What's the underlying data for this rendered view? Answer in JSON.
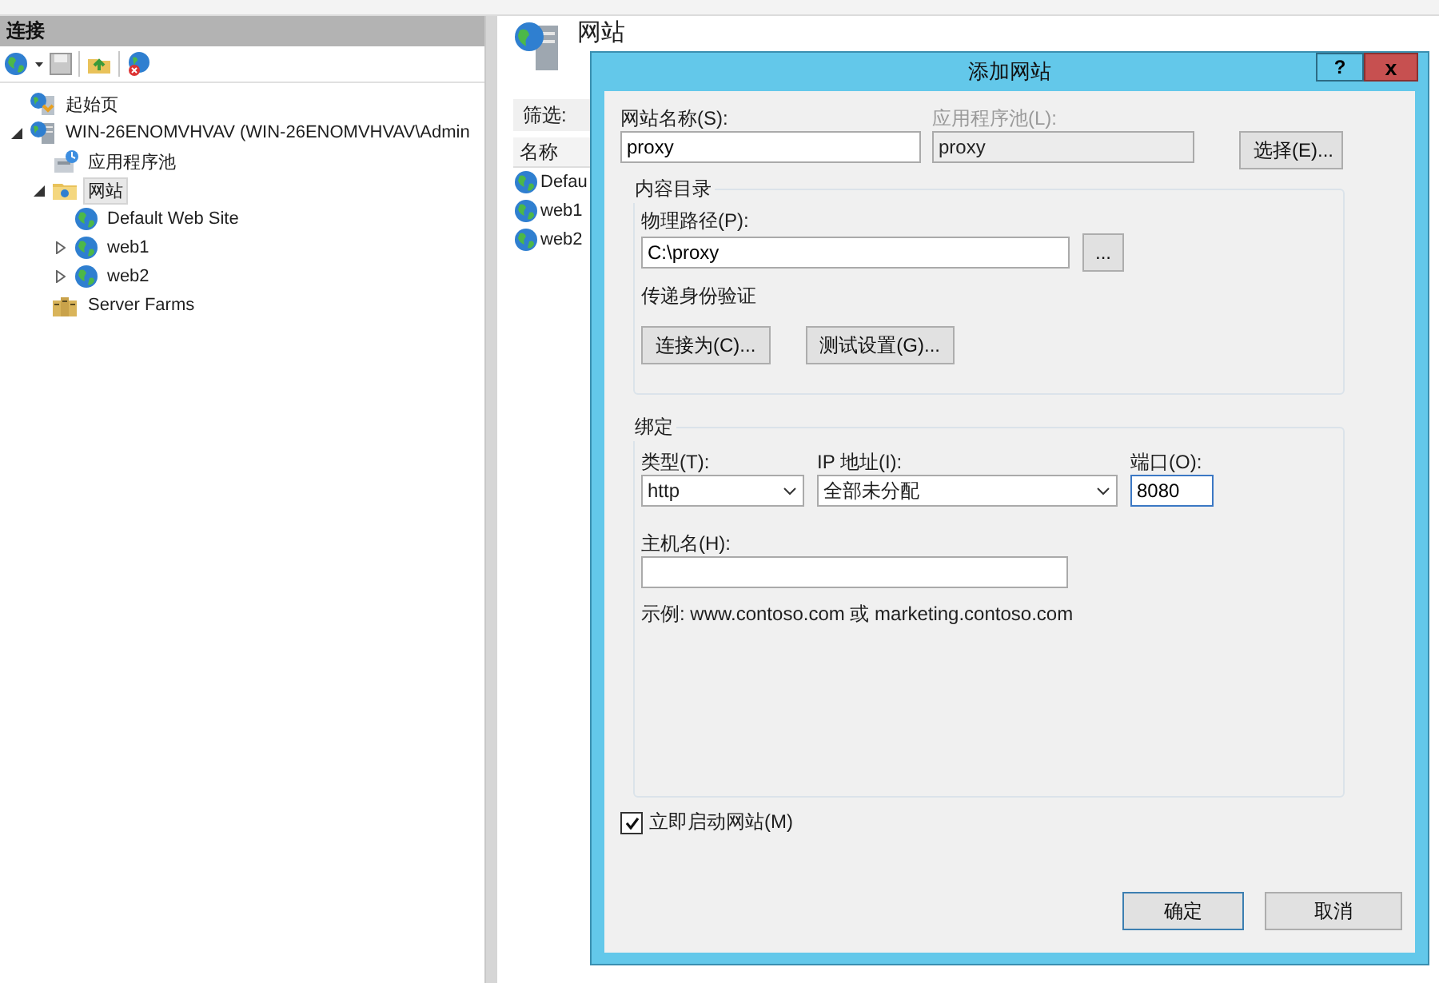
{
  "connections": {
    "title": "连接",
    "tree": [
      {
        "label": "起始页",
        "kind": "start",
        "selected": false
      },
      {
        "label": "WIN-26ENOMVHVAV (WIN-26ENOMVHVAV\\Admin",
        "kind": "server",
        "selected": false,
        "expanded": true,
        "children": [
          {
            "label": "应用程序池",
            "kind": "pool",
            "selected": false
          },
          {
            "label": "网站",
            "kind": "sites",
            "selected": true,
            "expanded": true,
            "children": [
              {
                "label": "Default Web Site",
                "kind": "site",
                "selected": false
              },
              {
                "label": "web1",
                "kind": "site",
                "selected": false,
                "expanded": false
              },
              {
                "label": "web2",
                "kind": "site",
                "selected": false,
                "expanded": false
              }
            ]
          },
          {
            "label": "Server Farms",
            "kind": "farms",
            "selected": false
          }
        ]
      }
    ]
  },
  "sites_page": {
    "heading": "网站",
    "filter_label": "筛选:",
    "columns": [
      "名称"
    ],
    "rows": [
      "Defau",
      "web1",
      "web2"
    ]
  },
  "dialog": {
    "title": "添加网站",
    "help": "?",
    "close": "x",
    "site_name": {
      "label": "网站名称(S):",
      "value": "proxy"
    },
    "app_pool": {
      "label": "应用程序池(L):",
      "value": "proxy",
      "disabled": true
    },
    "select_button": "选择(E)...",
    "content": {
      "title": "内容目录",
      "path_label": "物理路径(P):",
      "path_value": "C:\\proxy",
      "browse_button": "...",
      "auth_label": "传递身份验证",
      "connect_button": "连接为(C)...",
      "test_button": "测试设置(G)..."
    },
    "binding": {
      "title": "绑定",
      "type_label": "类型(T):",
      "type_value": "http",
      "ip_label": "IP 地址(I):",
      "ip_value": "全部未分配",
      "port_label": "端口(O):",
      "port_value": "8080",
      "host_label": "主机名(H):",
      "example": "示例: www.contoso.com 或 marketing.contoso.com"
    },
    "start_now": {
      "label": "立即启动网站(M)",
      "checked": true
    },
    "buttons": [
      {
        "label": "确定",
        "default": true
      },
      {
        "label": "取消",
        "default": false
      }
    ]
  }
}
